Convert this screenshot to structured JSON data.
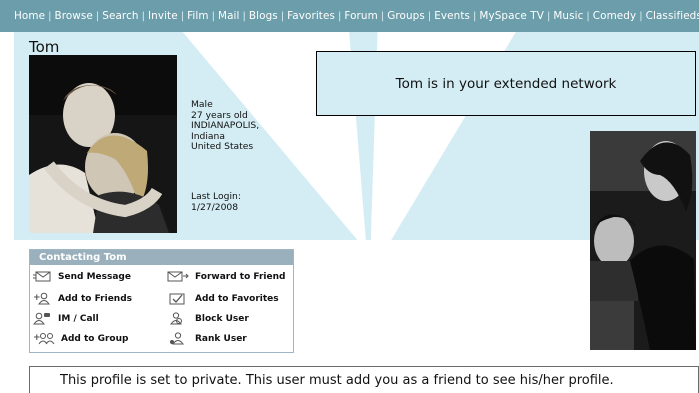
{
  "nav": [
    "Home",
    "Browse",
    "Search",
    "Invite",
    "Film",
    "Mail",
    "Blogs",
    "Favorites",
    "Forum",
    "Groups",
    "Events",
    "MySpace TV",
    "Music",
    "Comedy",
    "Classifieds"
  ],
  "profile": {
    "name": "Tom",
    "gender": "Male",
    "age": "27 years old",
    "city": "INDIANAPOLIS,",
    "state": "Indiana",
    "country": "United States",
    "last_login_label": "Last Login:",
    "last_login_date": "1/27/2008"
  },
  "extended_network_text": "Tom is in your extended network",
  "contact": {
    "title": "Contacting Tom",
    "items": [
      {
        "label": "Send Message",
        "icon": "envelope-icon"
      },
      {
        "label": "Forward to Friend",
        "icon": "forward-envelope-icon"
      },
      {
        "label": "Add to Friends",
        "icon": "add-person-icon"
      },
      {
        "label": "Add to Favorites",
        "icon": "favorites-icon"
      },
      {
        "label": "IM / Call",
        "icon": "im-call-icon"
      },
      {
        "label": "Block User",
        "icon": "block-user-icon"
      },
      {
        "label": "Add to Group",
        "icon": "add-group-icon"
      },
      {
        "label": "Rank User",
        "icon": "rank-user-icon"
      }
    ]
  },
  "private_notice": "This profile is set to private. This user must add you as a friend to see his/her profile."
}
